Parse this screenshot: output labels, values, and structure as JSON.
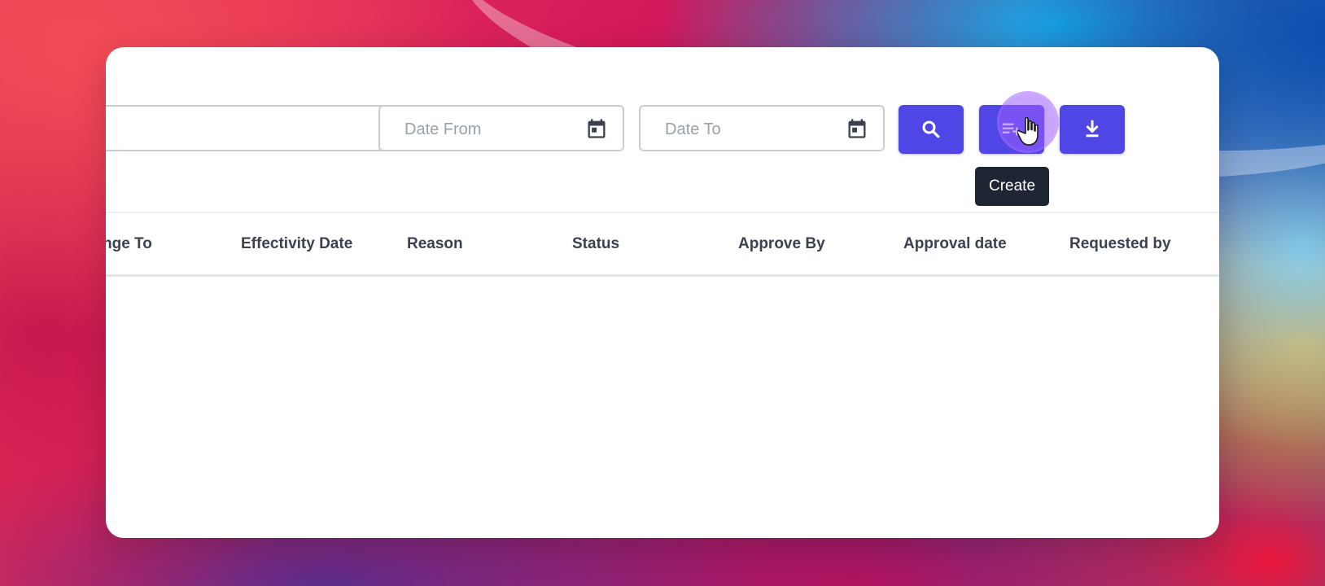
{
  "filters": {
    "select_value": "",
    "date_from_placeholder": "Date From",
    "date_to_placeholder": "Date To"
  },
  "tooltip": {
    "create_label": "Create"
  },
  "table": {
    "columns": [
      "nge To",
      "Effectivity Date",
      "Reason",
      "Status",
      "Approve By",
      "Approval date",
      "Requested by"
    ]
  },
  "colors": {
    "primary": "#4f46e5",
    "tooltip_bg": "#1f2633",
    "border": "#c9ccd6",
    "cursor_highlight": "#9b5cff"
  },
  "icons": {
    "search": "search-icon",
    "create": "playlist-add-icon",
    "download": "download-icon",
    "calendar": "calendar-icon",
    "dropdown": "caret-down-icon"
  }
}
